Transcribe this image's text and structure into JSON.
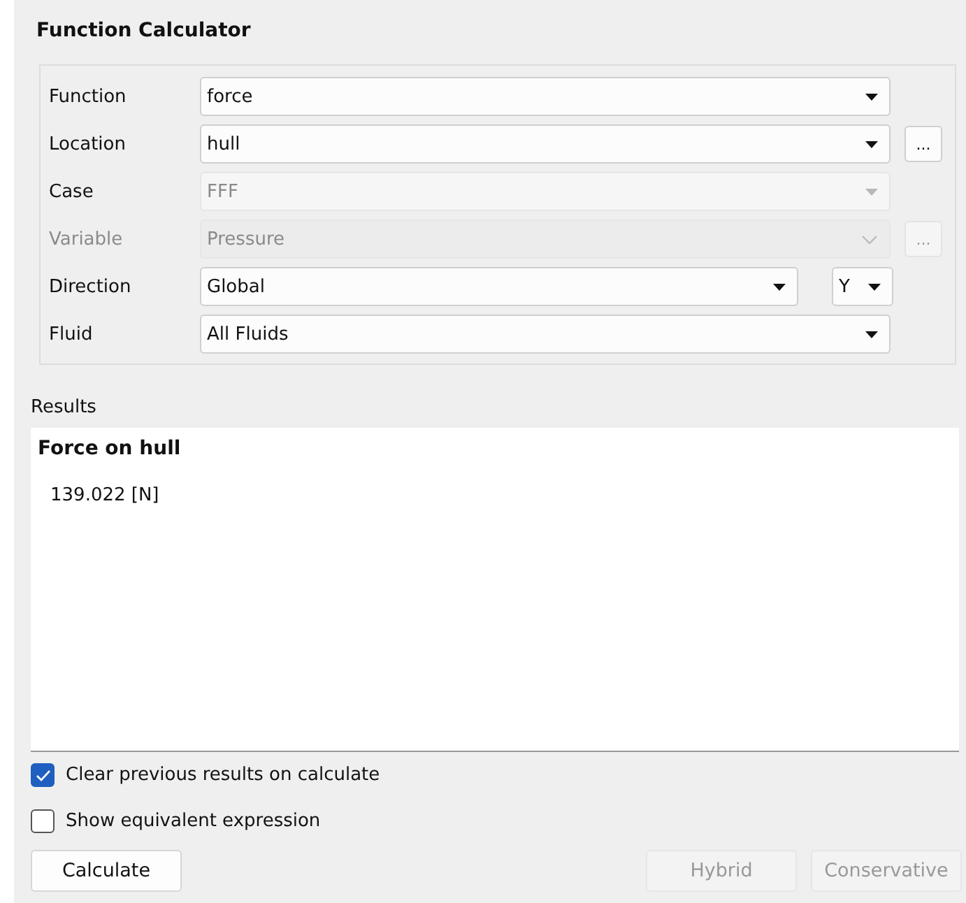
{
  "panel_title": "Function Calculator",
  "fields": [
    {
      "label": "Function",
      "value": "force",
      "disabled": false,
      "kind": "select"
    },
    {
      "label": "Location",
      "value": "hull",
      "disabled": false,
      "kind": "select",
      "browse": {
        "label": "...",
        "disabled": false
      }
    },
    {
      "label": "Case",
      "value": "FFF",
      "disabled": true,
      "kind": "select"
    },
    {
      "label": "Variable",
      "value": "Pressure",
      "disabled": true,
      "kind": "editable",
      "browse": {
        "label": "...",
        "disabled": true
      }
    },
    {
      "label": "Direction",
      "value": "Global",
      "disabled": false,
      "kind": "select",
      "axis": "Y"
    },
    {
      "label": "Fluid",
      "value": "All Fluids",
      "disabled": false,
      "kind": "select"
    }
  ],
  "results": {
    "label": "Results",
    "heading": "Force on hull",
    "value": "139.022 [N]"
  },
  "options": [
    {
      "label": "Clear previous results on calculate",
      "checked": true
    },
    {
      "label": "Show equivalent expression",
      "checked": false
    }
  ],
  "buttons": [
    {
      "label": "Calculate",
      "disabled": false,
      "kind": "left"
    },
    {
      "label": "Hybrid",
      "disabled": true,
      "kind": "right"
    },
    {
      "label": "Conservative",
      "disabled": true,
      "kind": "right"
    }
  ]
}
